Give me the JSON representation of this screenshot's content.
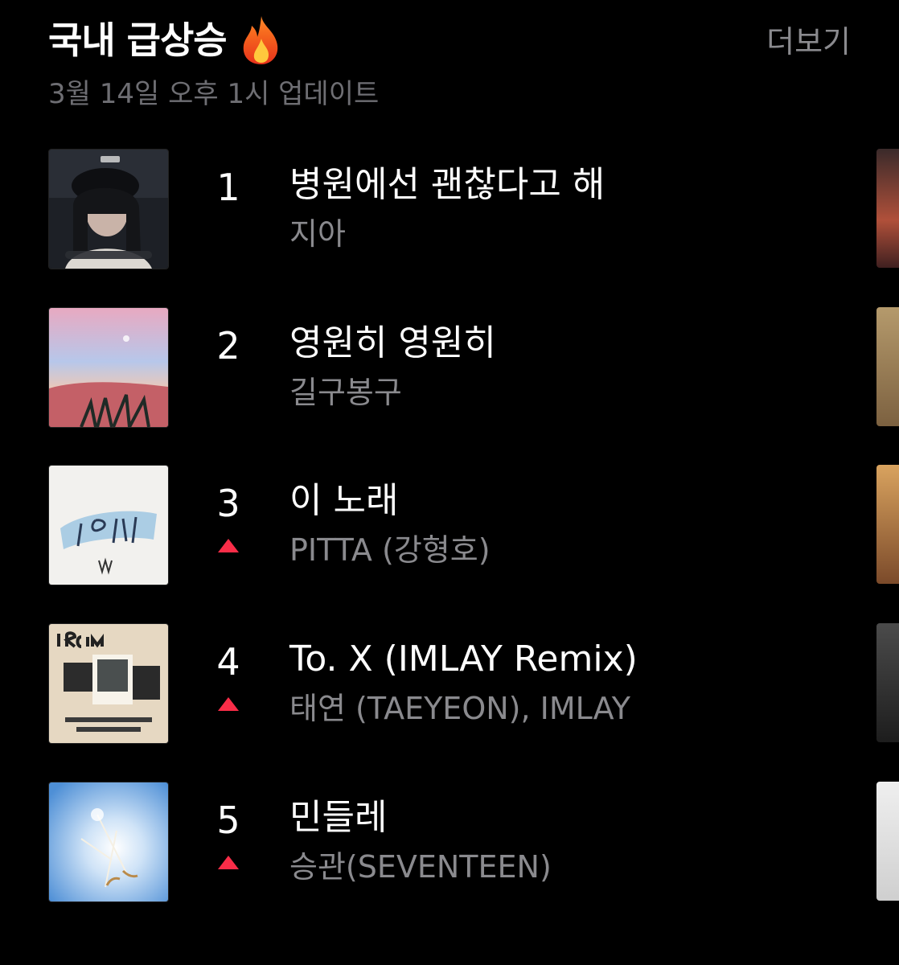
{
  "header": {
    "title": "국내 급상승",
    "more_label": "더보기",
    "subtitle": "3월 14일 오후 1시 업데이트"
  },
  "colors": {
    "background": "#000000",
    "secondary_text": "#8a8a8e",
    "trend_up": "#fa2d48"
  },
  "songs": [
    {
      "rank": "1",
      "title": "병원에선 괜찮다고 해",
      "artist": "지아",
      "trend": "none",
      "art_icon": "album-art-1"
    },
    {
      "rank": "2",
      "title": "영원히 영원히",
      "artist": "길구봉구",
      "trend": "none",
      "art_icon": "album-art-2"
    },
    {
      "rank": "3",
      "title": "이 노래",
      "artist": "PITTA (강형호)",
      "trend": "up",
      "art_icon": "album-art-3"
    },
    {
      "rank": "4",
      "title": "To. X (IMLAY Remix)",
      "artist": "태연 (TAEYEON), IMLAY",
      "trend": "up",
      "art_icon": "album-art-4"
    },
    {
      "rank": "5",
      "title": "민들레",
      "artist": "승관(SEVENTEEN)",
      "trend": "up",
      "art_icon": "album-art-5"
    }
  ]
}
